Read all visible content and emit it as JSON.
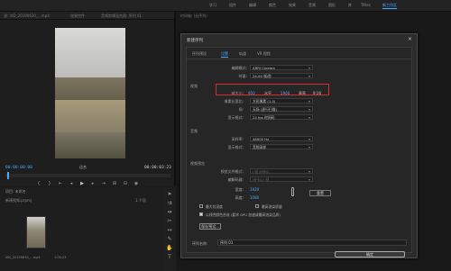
{
  "topbar": {
    "tabs": [
      "学习",
      "组件",
      "编辑",
      "颜色",
      "效果",
      "音频",
      "图形",
      "库",
      "Titles",
      "新工作区"
    ],
    "active_index": 9
  },
  "source_monitor": {
    "tabs": [
      "源: VID_20190630_...mp4",
      "效果控件",
      "音频剪辑混合器: 序列 01"
    ],
    "timecode_in": "00:00:00:00",
    "timecode_out": "00:00:03:23",
    "fit_label": "适合"
  },
  "project_panel": {
    "tab_label": "项目: 未命名",
    "file_name": "新建视频.prproj",
    "item_count": "1 个项",
    "clip_name": "VID_20190630_...mp4",
    "clip_duration": "1:00:23"
  },
  "timeline": {
    "tabs": "时间轴: (无序列)"
  },
  "dialog": {
    "title": "新建序列",
    "close": "×",
    "tabs": [
      "序列预设",
      "设置",
      "轨道",
      "VR 视频"
    ],
    "active_tab_index": 1,
    "edit_mode_label": "编辑模式:",
    "edit_mode_value": "ARRI Cinema",
    "timebase_label": "时基:",
    "timebase_value": "24.00 帧/秒",
    "video_section": "视频",
    "frame_size_label": "帧大小:",
    "frame_width": "950",
    "horizontal_label": "水平",
    "frame_height": "1960",
    "vertical_label": "垂直",
    "aspect_ratio": "9:16",
    "pixel_aspect_label": "像素长宽比:",
    "pixel_aspect_value": "方形像素 (1.0)",
    "fields_label": "场:",
    "fields_value": "无场 (逐行扫描)",
    "display_format_label": "显示格式:",
    "display_format_value": "24 fps 时间码",
    "audio_section": "音频",
    "sample_rate_label": "采样率:",
    "sample_rate_value": "48000 Hz",
    "audio_display_label": "显示格式:",
    "audio_display_value": "音频采样",
    "preview_section": "视频预览",
    "preview_file_label": "预览文件格式:",
    "preview_file_value": "I 帧 MPEG",
    "codec_label": "编解码器:",
    "codec_value": "MPEG I 帧",
    "width_label": "宽度:",
    "width_value": "1920",
    "height_label": "高度:",
    "height_value": "1080",
    "reset_label": "重置",
    "max_bit_depth_label": "最大位深度",
    "max_render_quality_label": "最高渲染质量",
    "linear_color_label": "以线性颜色合成 (要求 GPU 加速或最高渲染品质)",
    "save_preset_label": "保存预设...",
    "seq_name_label": "序列名称:",
    "seq_name_value": "序列 01",
    "ok_label": "确定"
  }
}
